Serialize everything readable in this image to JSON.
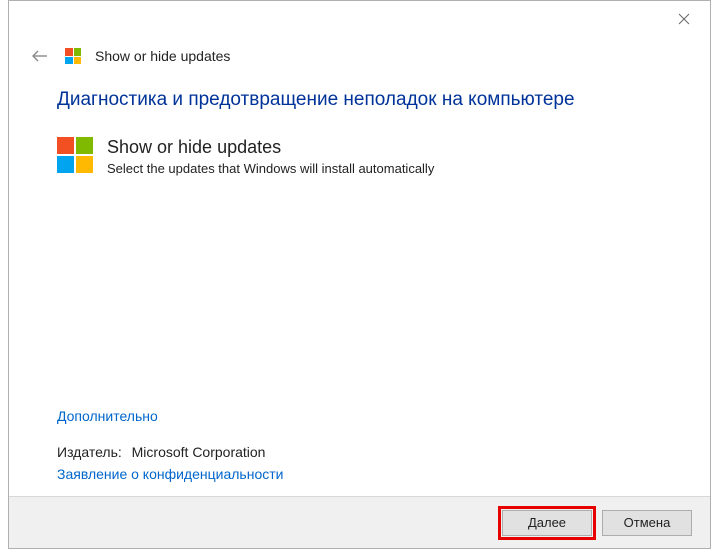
{
  "header": {
    "title": "Show or hide updates"
  },
  "main": {
    "heading": "Диагностика и предотвращение неполадок на компьютере",
    "app_title": "Show or hide updates",
    "app_desc": "Select the updates that Windows will install automatically"
  },
  "links": {
    "advanced": "Дополнительно",
    "privacy": "Заявление о конфиденциальности"
  },
  "publisher": {
    "label": "Издатель:",
    "value": "Microsoft Corporation"
  },
  "footer": {
    "next": "Далее",
    "cancel": "Отмена"
  }
}
